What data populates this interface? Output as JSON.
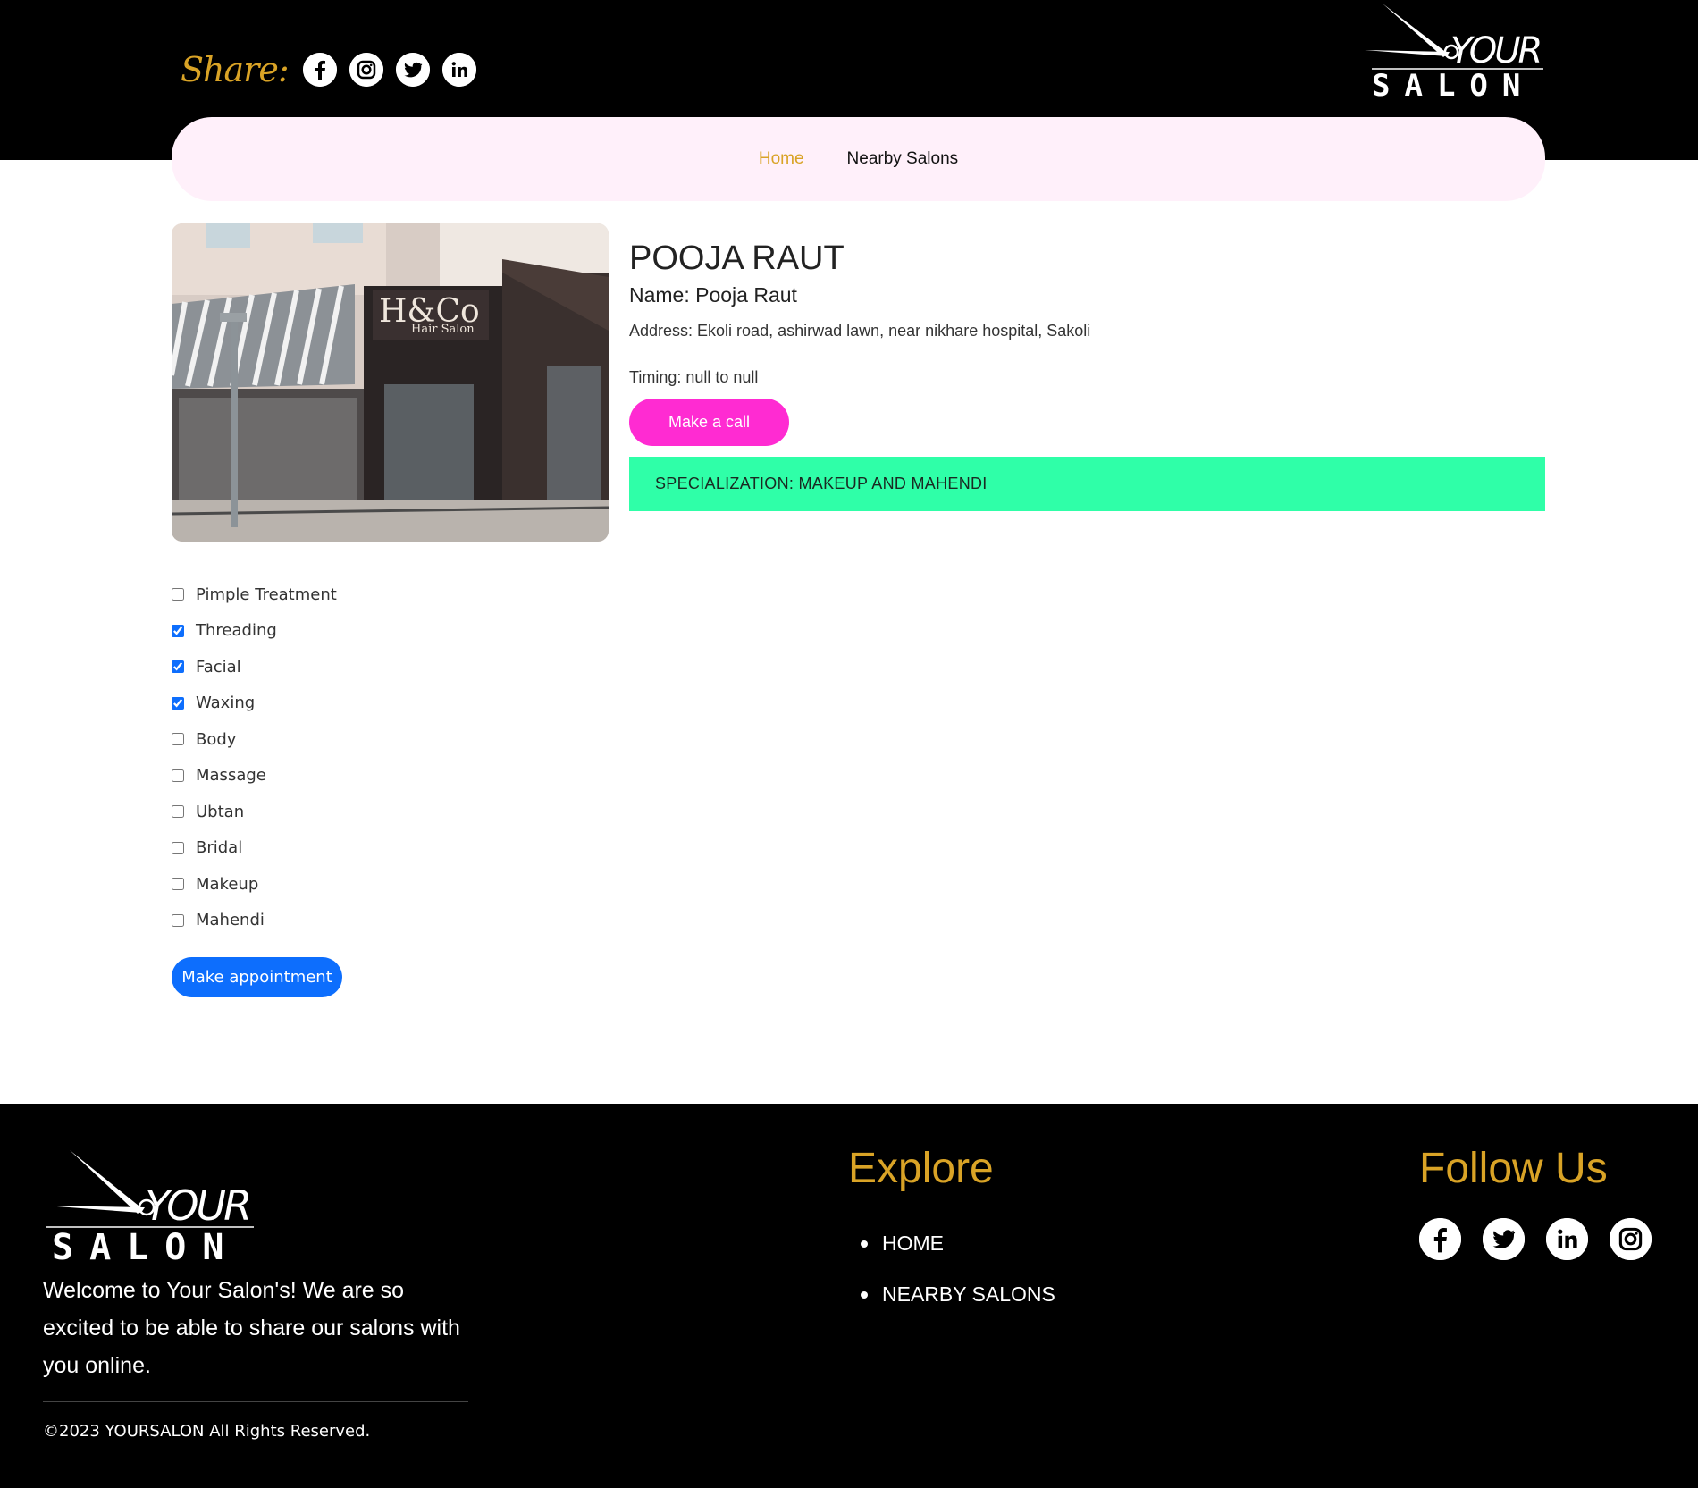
{
  "header": {
    "share_label": "Share:",
    "share_icons": [
      "facebook-icon",
      "instagram-icon",
      "twitter-icon",
      "linkedin-icon"
    ],
    "logo_top": "YOUR",
    "logo_bottom": "SALON"
  },
  "nav": {
    "items": [
      {
        "label": "Home",
        "active": true
      },
      {
        "label": "Nearby Salons",
        "active": false
      }
    ]
  },
  "salon": {
    "title": "POOJA RAUT",
    "name": "Name: Pooja Raut",
    "address": "Address: Ekoli road, ashirwad lawn, near nikhare hospital, Sakoli",
    "timing": "Timing: null to null",
    "call_button": "Make a call",
    "specialization": "SPECIALIZATION:  MAKEUP AND MAHENDI",
    "image_sign_1": "H&Co",
    "image_sign_2": "Hair Salon"
  },
  "services": [
    {
      "label": "Pimple Treatment",
      "checked": false
    },
    {
      "label": "Threading",
      "checked": true
    },
    {
      "label": "Facial",
      "checked": true
    },
    {
      "label": "Waxing",
      "checked": true
    },
    {
      "label": "Body",
      "checked": false
    },
    {
      "label": "Massage",
      "checked": false
    },
    {
      "label": "Ubtan",
      "checked": false
    },
    {
      "label": "Bridal",
      "checked": false
    },
    {
      "label": "Makeup",
      "checked": false
    },
    {
      "label": "Mahendi",
      "checked": false
    }
  ],
  "appointment_button": "Make appointment",
  "footer": {
    "welcome": "Welcome to Your Salon's! We are so excited to be able to share our salons with you online.",
    "copyright": "©2023 YOURSALON All Rights Reserved.",
    "explore_title": "Explore",
    "explore_links": [
      "HOME",
      "NEARBY SALONS"
    ],
    "follow_title": "Follow Us",
    "follow_icons": [
      "facebook-icon",
      "twitter-icon",
      "linkedin-icon",
      "instagram-icon"
    ]
  },
  "colors": {
    "accent_gold": "#d9a326",
    "call_pink": "#ff2bd2",
    "spec_green": "#2fffa8",
    "nav_bg": "#fff0fa",
    "primary_blue": "#0d6efd"
  }
}
